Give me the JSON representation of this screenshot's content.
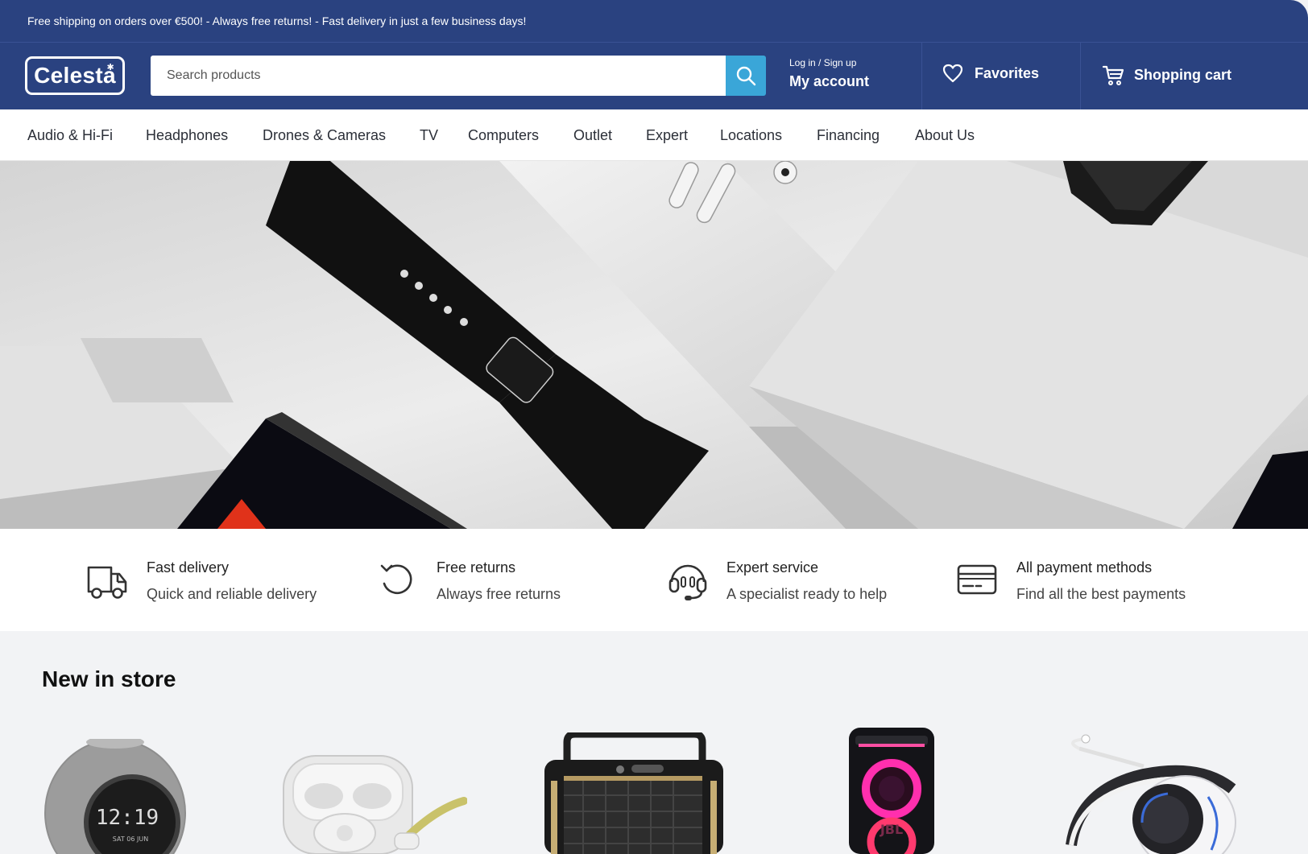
{
  "promo": {
    "text": "Free shipping on orders over €500! - Always free returns! - Fast delivery in just a few business days!"
  },
  "header": {
    "logo": "Celesta",
    "search_placeholder": "Search products",
    "account_small": "Log in / Sign up",
    "account_big": "My account",
    "favorites": "Favorites",
    "cart": "Shopping cart"
  },
  "nav": {
    "items": [
      "Audio & Hi-Fi",
      "Headphones",
      "Drones & Cameras",
      "TV",
      "Computers",
      "Outlet",
      "Expert",
      "Locations",
      "Financing",
      "About Us"
    ]
  },
  "features": [
    {
      "title": "Fast delivery",
      "subtitle": "Quick and reliable delivery",
      "icon": "truck-icon"
    },
    {
      "title": "Free returns",
      "subtitle": "Always free returns",
      "icon": "return-icon"
    },
    {
      "title": "Expert service",
      "subtitle": "A specialist ready to help",
      "icon": "headset-icon"
    },
    {
      "title": "All payment methods",
      "subtitle": "Find all the best payments",
      "icon": "credit-card-icon"
    }
  ],
  "new_in_store": {
    "title": "New in store",
    "products": [
      {
        "name": "clock-radio"
      },
      {
        "name": "wireless-earbuds"
      },
      {
        "name": "retro-speaker"
      },
      {
        "name": "party-speaker"
      },
      {
        "name": "gaming-headset"
      }
    ]
  },
  "clock_display": {
    "time": "12:19",
    "date": "SAT 06 JUN"
  },
  "colors": {
    "brand": "#2a4280",
    "accent": "#3aa6d8",
    "background": "#f2f3f5"
  }
}
